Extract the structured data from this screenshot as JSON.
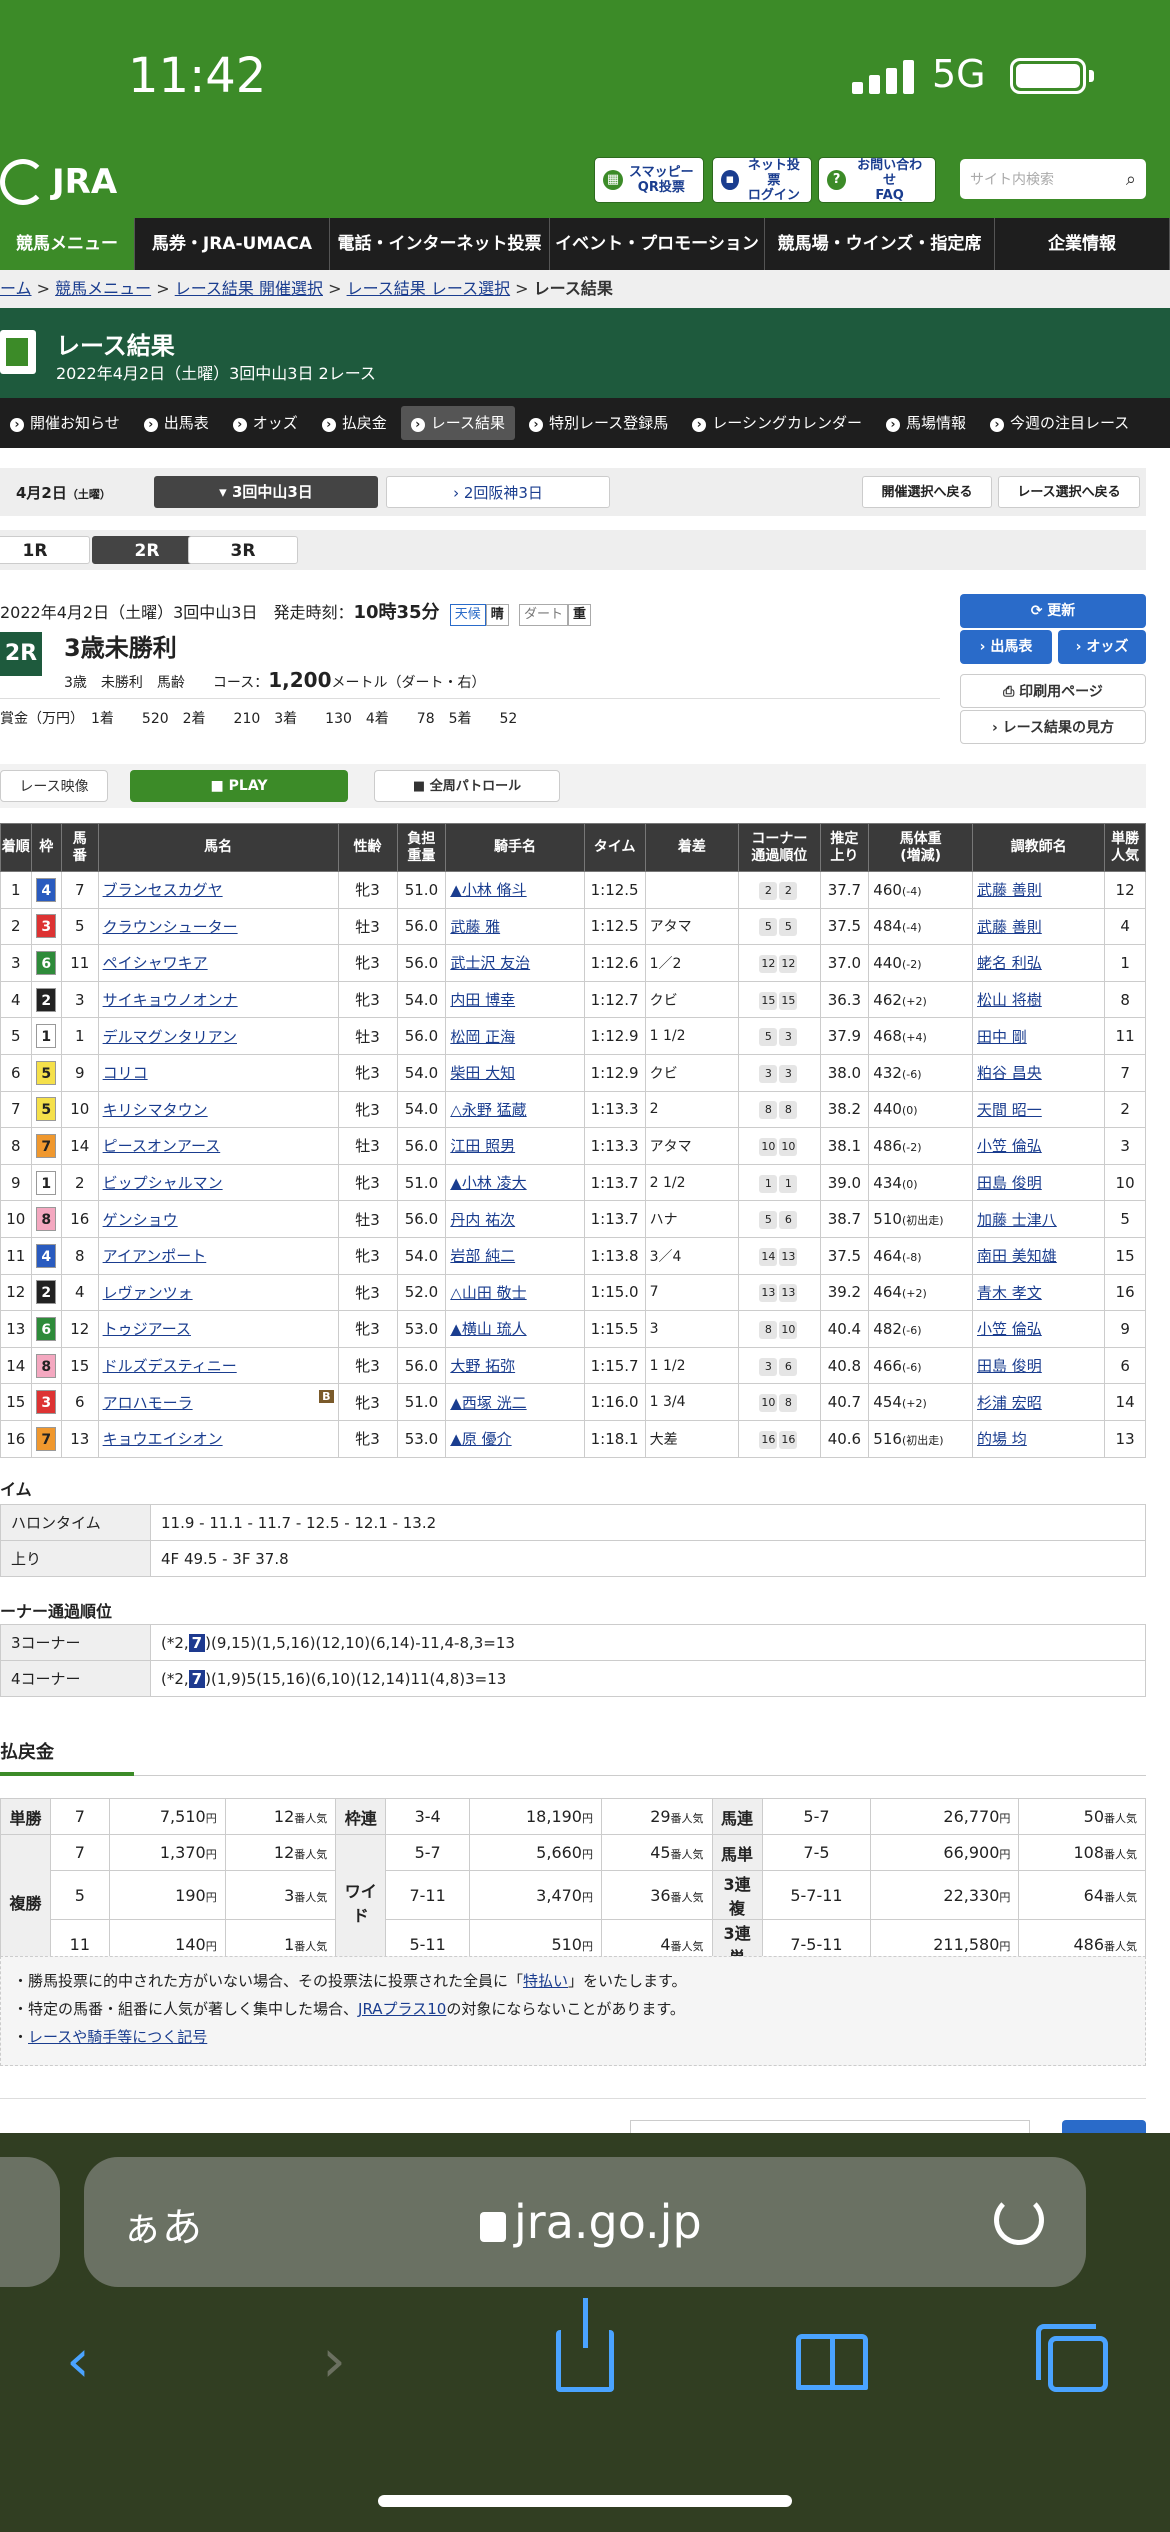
{
  "status": {
    "time": "11:42",
    "network": "5G"
  },
  "header": {
    "logo": "JRA",
    "btn_qr": "スマッピー\nQR投票",
    "btn_login": "ネット投票\nログイン",
    "btn_faq": "お問い合わせ\nFAQ",
    "search_placeholder": "サイト内検索"
  },
  "main_nav": [
    "競馬メニュー",
    "馬券・JRA-UMACA",
    "電話・インターネット投票",
    "イベント・プロモーション",
    "競馬場・ウインズ・指定席",
    "企業情報"
  ],
  "breadcrumb": [
    "ーム",
    "競馬メニュー",
    "レース結果 開催選択",
    "レース結果 レース選択",
    "レース結果"
  ],
  "title": {
    "main": "レース結果",
    "sub": "2022年4月2日（土曜）3回中山3日 2レース"
  },
  "sub_nav": [
    "開催お知らせ",
    "出馬表",
    "オッズ",
    "払戻金",
    "レース結果",
    "特別レース登録馬",
    "レーシングカレンダー",
    "馬場情報",
    "今週の注目レース"
  ],
  "date_select": {
    "date": "4月2日",
    "dow": "（土曜）",
    "venue1": "3回中山3日",
    "venue2": "2回阪神3日",
    "back1": "開催選択へ戻る",
    "back2": "レース選択へ戻る"
  },
  "race_tabs": [
    "1R",
    "2R",
    "3R"
  ],
  "race": {
    "info": "2022年4月2日（土曜）3回中山3日　発走時刻：",
    "start_time": "10時35分",
    "weather_label": "天候",
    "weather": "晴",
    "track_label": "ダート",
    "track": "重",
    "num": "2R",
    "name": "3歳未勝利",
    "cond": "3歳　未勝利　馬齢",
    "course_label": "コース：",
    "course_dist": "1,200",
    "course_unit": "メートル（ダート・右）",
    "prize": "賞金（万円）　1着　　520　2着　　210　3着　　130　4着　　78　5着　　52"
  },
  "buttons": {
    "refresh": "更新",
    "entries": "出馬表",
    "odds": "オッズ",
    "print": "印刷用ページ",
    "howto": "レース結果の見方",
    "video": "レース映像",
    "play": "PLAY",
    "patrol": "全周パトロール"
  },
  "table_headers": [
    "着順",
    "枠",
    "馬番",
    "馬名",
    "性齢",
    "負担\n重量",
    "騎手名",
    "タイム",
    "着差",
    "コーナー\n通過順位",
    "推定\n上り",
    "馬体重\n(増減)",
    "調教師名",
    "単勝\n人気"
  ],
  "results": [
    {
      "rank": "1",
      "waku": "4",
      "num": "7",
      "horse": "ブランセスカグヤ",
      "sa": "牝3",
      "wt": "51.0",
      "jockey": "▲小林 脩斗",
      "time": "1:12.5",
      "margin": "",
      "c1": "2",
      "c2": "2",
      "last": "37.7",
      "bw": "460",
      "bd": "(-4)",
      "trainer": "武藤 善則",
      "pop": "12"
    },
    {
      "rank": "2",
      "waku": "3",
      "num": "5",
      "horse": "クラウンシューター",
      "sa": "牡3",
      "wt": "56.0",
      "jockey": "武藤 雅",
      "time": "1:12.5",
      "margin": "アタマ",
      "c1": "5",
      "c2": "5",
      "last": "37.5",
      "bw": "484",
      "bd": "(-4)",
      "trainer": "武藤 善則",
      "pop": "4"
    },
    {
      "rank": "3",
      "waku": "6",
      "num": "11",
      "horse": "ペイシャワキア",
      "sa": "牝3",
      "wt": "56.0",
      "jockey": "武士沢 友治",
      "time": "1:12.6",
      "margin": "1／2",
      "c1": "12",
      "c2": "12",
      "last": "37.0",
      "bw": "440",
      "bd": "(-2)",
      "trainer": "蛯名 利弘",
      "pop": "1"
    },
    {
      "rank": "4",
      "waku": "2",
      "num": "3",
      "horse": "サイキョウノオンナ",
      "sa": "牝3",
      "wt": "54.0",
      "jockey": "内田 博幸",
      "time": "1:12.7",
      "margin": "クビ",
      "c1": "15",
      "c2": "15",
      "last": "36.3",
      "bw": "462",
      "bd": "(+2)",
      "trainer": "松山 将樹",
      "pop": "8"
    },
    {
      "rank": "5",
      "waku": "1",
      "num": "1",
      "horse": "デルマグンタリアン",
      "sa": "牡3",
      "wt": "56.0",
      "jockey": "松岡 正海",
      "time": "1:12.9",
      "margin": "1 1/2",
      "c1": "5",
      "c2": "3",
      "last": "37.9",
      "bw": "468",
      "bd": "(+4)",
      "trainer": "田中 剛",
      "pop": "11"
    },
    {
      "rank": "6",
      "waku": "5",
      "num": "9",
      "horse": "コリコ",
      "sa": "牝3",
      "wt": "54.0",
      "jockey": "柴田 大知",
      "time": "1:12.9",
      "margin": "クビ",
      "c1": "3",
      "c2": "3",
      "last": "38.0",
      "bw": "432",
      "bd": "(-6)",
      "trainer": "粕谷 昌央",
      "pop": "7"
    },
    {
      "rank": "7",
      "waku": "5",
      "num": "10",
      "horse": "キリシマタウン",
      "sa": "牝3",
      "wt": "54.0",
      "jockey": "△永野 猛蔵",
      "time": "1:13.3",
      "margin": "2",
      "c1": "8",
      "c2": "8",
      "last": "38.2",
      "bw": "440",
      "bd": "(0)",
      "trainer": "天間 昭一",
      "pop": "2"
    },
    {
      "rank": "8",
      "waku": "7",
      "num": "14",
      "horse": "ピースオンアース",
      "sa": "牡3",
      "wt": "56.0",
      "jockey": "江田 照男",
      "time": "1:13.3",
      "margin": "アタマ",
      "c1": "10",
      "c2": "10",
      "last": "38.1",
      "bw": "486",
      "bd": "(-2)",
      "trainer": "小笠 倫弘",
      "pop": "3"
    },
    {
      "rank": "9",
      "waku": "1",
      "num": "2",
      "horse": "ビップシャルマン",
      "sa": "牝3",
      "wt": "51.0",
      "jockey": "▲小林 凌大",
      "time": "1:13.7",
      "margin": "2 1/2",
      "c1": "1",
      "c2": "1",
      "last": "39.0",
      "bw": "434",
      "bd": "(0)",
      "trainer": "田島 俊明",
      "pop": "10"
    },
    {
      "rank": "10",
      "waku": "8",
      "num": "16",
      "horse": "ゲンショウ",
      "sa": "牡3",
      "wt": "56.0",
      "jockey": "丹内 祐次",
      "time": "1:13.7",
      "margin": "ハナ",
      "c1": "5",
      "c2": "6",
      "last": "38.7",
      "bw": "510",
      "bd": "(初出走)",
      "trainer": "加藤 士津八",
      "pop": "5"
    },
    {
      "rank": "11",
      "waku": "4",
      "num": "8",
      "horse": "アイアンポート",
      "sa": "牝3",
      "wt": "54.0",
      "jockey": "岩部 純二",
      "time": "1:13.8",
      "margin": "3／4",
      "c1": "14",
      "c2": "13",
      "last": "37.5",
      "bw": "464",
      "bd": "(-8)",
      "trainer": "南田 美知雄",
      "pop": "15"
    },
    {
      "rank": "12",
      "waku": "2",
      "num": "4",
      "horse": "レヴァンツォ",
      "sa": "牝3",
      "wt": "52.0",
      "jockey": "△山田 敬士",
      "time": "1:15.0",
      "margin": "7",
      "c1": "13",
      "c2": "13",
      "last": "39.2",
      "bw": "464",
      "bd": "(+2)",
      "trainer": "青木 孝文",
      "pop": "16"
    },
    {
      "rank": "13",
      "waku": "6",
      "num": "12",
      "horse": "トゥジアース",
      "sa": "牝3",
      "wt": "53.0",
      "jockey": "▲横山 琉人",
      "time": "1:15.5",
      "margin": "3",
      "c1": "8",
      "c2": "10",
      "last": "40.4",
      "bw": "482",
      "bd": "(-6)",
      "trainer": "小笠 倫弘",
      "pop": "9"
    },
    {
      "rank": "14",
      "waku": "8",
      "num": "15",
      "horse": "ドルズデスティニー",
      "sa": "牝3",
      "wt": "56.0",
      "jockey": "大野 拓弥",
      "time": "1:15.7",
      "margin": "1 1/2",
      "c1": "3",
      "c2": "6",
      "last": "40.8",
      "bw": "466",
      "bd": "(-6)",
      "trainer": "田島 俊明",
      "pop": "6"
    },
    {
      "rank": "15",
      "waku": "3",
      "num": "6",
      "horse": "アロハモーラ",
      "sa": "牝3",
      "wt": "51.0",
      "jockey": "▲西塚 洸二",
      "time": "1:16.0",
      "margin": "1 3/4",
      "c1": "10",
      "c2": "8",
      "last": "40.7",
      "bw": "454",
      "bd": "(+2)",
      "trainer": "杉浦 宏昭",
      "pop": "14",
      "blinker": "B"
    },
    {
      "rank": "16",
      "waku": "7",
      "num": "13",
      "horse": "キョウエイシオン",
      "sa": "牝3",
      "wt": "53.0",
      "jockey": "▲原 優介",
      "time": "1:18.1",
      "margin": "大差",
      "c1": "16",
      "c2": "16",
      "last": "40.6",
      "bw": "516",
      "bd": "(初出走)",
      "trainer": "的場 均",
      "pop": "13"
    }
  ],
  "times": {
    "section": "イム",
    "halon_label": "ハロンタイム",
    "halon": "11.9 - 11.1 - 11.7 - 12.5 - 12.1 - 13.2",
    "agari_label": "上り",
    "agari": "4F 49.5 - 3F 37.8"
  },
  "corners": {
    "section": "ーナー通過順位",
    "c3_label": "3コーナー",
    "c3_pre": "(*2,",
    "c3_hl": "7",
    "c3_post": ")(9,15)(1,5,16)(12,10)(6,14)-11,4-8,3=13",
    "c4_label": "4コーナー",
    "c4_pre": "(*2,",
    "c4_hl": "7",
    "c4_post": ")(1,9)5(15,16)(6,10)(12,14)11(4,8)3=13"
  },
  "payout": {
    "section": "払戻金",
    "yen": "円",
    "ninki": "番人気",
    "tansho": {
      "label": "単勝",
      "combo": "7",
      "amount": "7,510",
      "pop": "12"
    },
    "fukusho": {
      "label": "複勝",
      "rows": [
        {
          "combo": "7",
          "amount": "1,370",
          "pop": "12"
        },
        {
          "combo": "5",
          "amount": "190",
          "pop": "3"
        },
        {
          "combo": "11",
          "amount": "140",
          "pop": "1"
        }
      ]
    },
    "wakuren": {
      "label": "枠連",
      "combo": "3-4",
      "amount": "18,190",
      "pop": "29"
    },
    "wide": {
      "label": "ワイド",
      "rows": [
        {
          "combo": "5-7",
          "amount": "5,660",
          "pop": "45"
        },
        {
          "combo": "7-11",
          "amount": "3,470",
          "pop": "36"
        },
        {
          "combo": "5-11",
          "amount": "510",
          "pop": "4"
        }
      ]
    },
    "umaren": {
      "label": "馬連",
      "combo": "5-7",
      "amount": "26,770",
      "pop": "50"
    },
    "umatan": {
      "label": "馬単",
      "combo": "7-5",
      "amount": "66,900",
      "pop": "108"
    },
    "sanrenpuku": {
      "label": "3連複",
      "combo": "5-7-11",
      "amount": "22,330",
      "pop": "64"
    },
    "sanrentan": {
      "label": "3連単",
      "combo": "7-5-11",
      "amount": "211,580",
      "pop": "486"
    }
  },
  "notes": {
    "n1_pre": "勝馬投票に的中された方がいない場合、その投票法に投票された全員に「",
    "n1_link": "特払い",
    "n1_post": "」をいたします。",
    "n2_pre": "特定の馬番・組番に人気が著しく集中した場合、",
    "n2_link": "JRAプラス10",
    "n2_post": "の対象にならないことがあります。",
    "n3_link": "レースや騎手等につく記号"
  },
  "safari": {
    "aa": "ぁあ",
    "url": "jra.go.jp"
  },
  "colors": {
    "accent": "#3c8b28",
    "dark_green": "#1e5a3d",
    "button_blue": "#2a6bc9"
  }
}
